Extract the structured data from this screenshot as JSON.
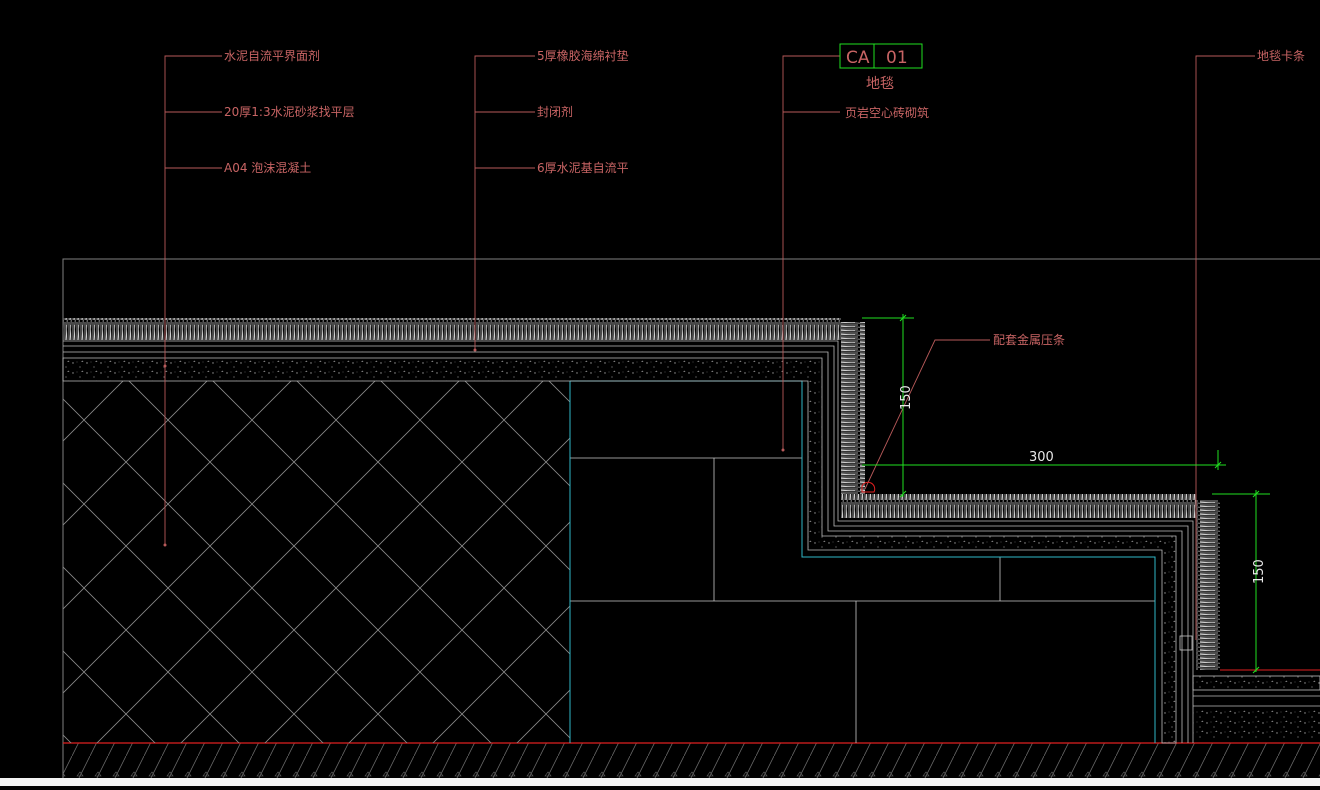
{
  "colors": {
    "background": "#000000",
    "leader": "#b85a5a",
    "label_text": "#c86464",
    "dimension": "#20e020",
    "frame": "#808080",
    "brick": "#c8c8c8",
    "insulation": "#30b8c8",
    "ground_line": "#e02020",
    "carpet": "#cfcfcf"
  },
  "labels_left": {
    "l1": "水泥自流平界面剂",
    "l2": "20厚1:3水泥砂浆找平层",
    "l3": "A04 泡沫混凝土"
  },
  "labels_mid": {
    "l1": "5厚橡胶海绵衬垫",
    "l2": "封闭剂",
    "l3": "6厚水泥基自流平"
  },
  "tag": {
    "code": "CA",
    "number": "01",
    "name": "地毯"
  },
  "labels_right": {
    "l1": "页岩空心砖砌筑",
    "trim": "配套金属压条",
    "edge": "地毯卡条"
  },
  "dimensions": {
    "riser_upper": "150",
    "tread": "300",
    "riser_lower": "150"
  },
  "status": {
    "cursor": "'"
  }
}
